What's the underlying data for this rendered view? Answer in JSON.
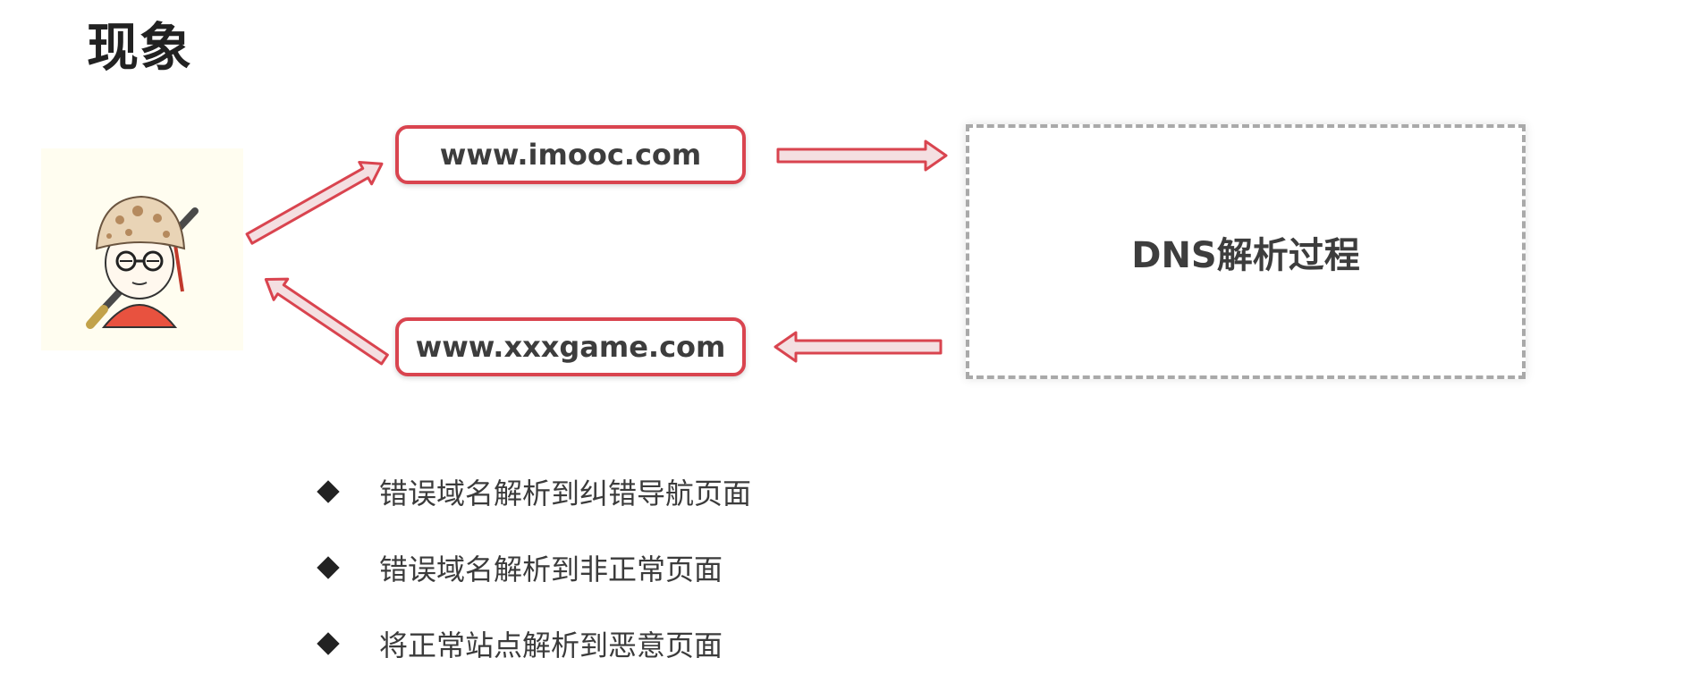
{
  "title": "现象",
  "diagram": {
    "domain_top": "www.imooc.com",
    "domain_bottom": "www.xxxgame.com",
    "dns_label": "DNS解析过程"
  },
  "bullets": [
    "错误域名解析到纠错导航页面",
    "错误域名解析到非正常页面",
    "将正常站点解析到恶意页面"
  ],
  "colors": {
    "accent": "#d9444f",
    "arrow_fill": "#f4dfe1",
    "dashed_border": "#a9a9a9",
    "text": "#3d3d3d"
  },
  "icons": {
    "avatar": "cartoon-person-with-hat-icon",
    "bullet": "diamond-icon"
  }
}
